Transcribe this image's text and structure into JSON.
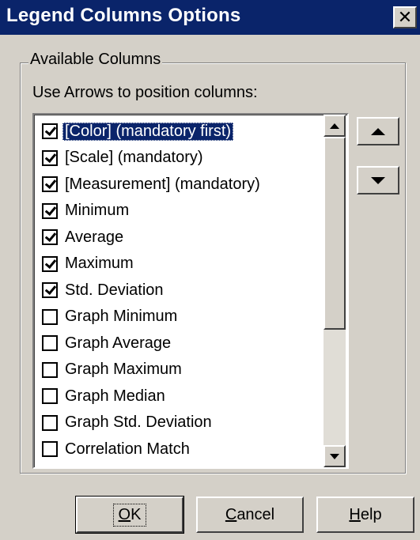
{
  "window": {
    "title": "Legend Columns Options",
    "close_label": "✕"
  },
  "group": {
    "label": "Available Columns",
    "instruction": "Use Arrows to position columns:"
  },
  "columns": [
    {
      "label": "[Color] (mandatory first)",
      "checked": true,
      "selected": true
    },
    {
      "label": "[Scale] (mandatory)",
      "checked": true,
      "selected": false
    },
    {
      "label": "[Measurement] (mandatory)",
      "checked": true,
      "selected": false
    },
    {
      "label": "Minimum",
      "checked": true,
      "selected": false
    },
    {
      "label": "Average",
      "checked": true,
      "selected": false
    },
    {
      "label": "Maximum",
      "checked": true,
      "selected": false
    },
    {
      "label": "Std. Deviation",
      "checked": true,
      "selected": false
    },
    {
      "label": "Graph Minimum",
      "checked": false,
      "selected": false
    },
    {
      "label": "Graph Average",
      "checked": false,
      "selected": false
    },
    {
      "label": "Graph Maximum",
      "checked": false,
      "selected": false
    },
    {
      "label": "Graph Median",
      "checked": false,
      "selected": false
    },
    {
      "label": "Graph Std. Deviation",
      "checked": false,
      "selected": false
    },
    {
      "label": "Correlation Match",
      "checked": false,
      "selected": false
    }
  ],
  "buttons": {
    "ok": {
      "mnemonic": "O",
      "rest": "K"
    },
    "cancel": {
      "mnemonic": "C",
      "rest": "ancel"
    },
    "help": {
      "mnemonic": "H",
      "rest": "elp"
    }
  },
  "colors": {
    "titlebar": "#0a246a",
    "dialog_face": "#d4d0c8",
    "selection": "#0a246a"
  }
}
